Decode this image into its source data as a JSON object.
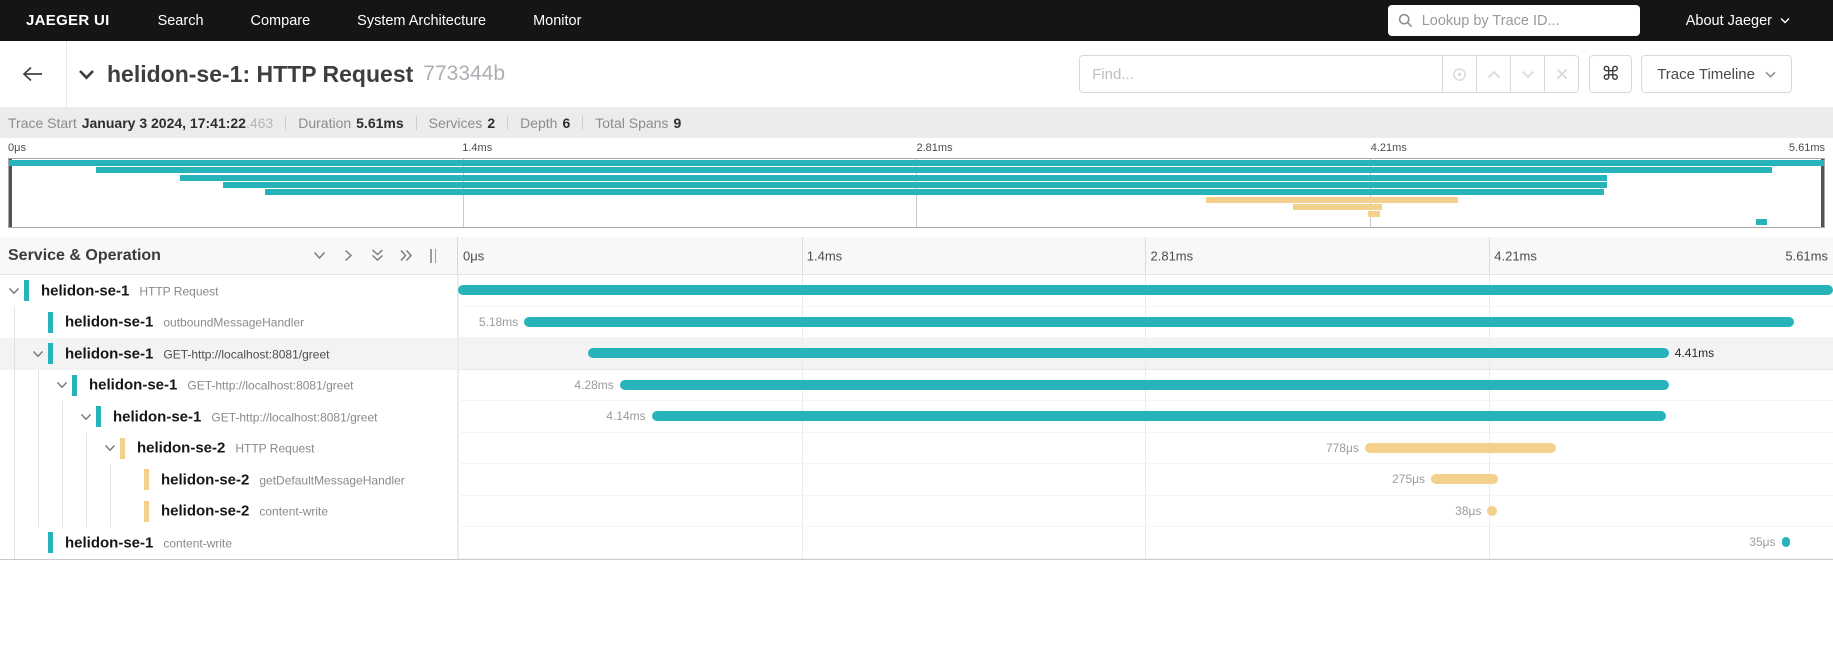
{
  "colors": {
    "teal": "#26b4ba",
    "yellow": "#f3d18c",
    "nav_bg": "#151515"
  },
  "nav": {
    "brand": "JAEGER UI",
    "items": [
      {
        "label": "Search"
      },
      {
        "label": "Compare"
      },
      {
        "label": "System Architecture"
      },
      {
        "label": "Monitor"
      }
    ],
    "trace_lookup_placeholder": "Lookup by Trace ID...",
    "about_label": "About Jaeger"
  },
  "trace_header": {
    "title": "helidon-se-1: HTTP Request",
    "trace_id": "773344b",
    "find_placeholder": "Find...",
    "cmd_glyph": "⌘",
    "view_selector_label": "Trace Timeline"
  },
  "summary": {
    "trace_start_label": "Trace Start",
    "trace_start_value": "January 3 2024, 17:41:22",
    "trace_start_fraction": ".463",
    "duration_label": "Duration",
    "duration_value": "5.61ms",
    "services_label": "Services",
    "services_value": "2",
    "depth_label": "Depth",
    "depth_value": "6",
    "total_spans_label": "Total Spans",
    "total_spans_value": "9"
  },
  "timeline": {
    "duration_ms": 5.61,
    "ticks": [
      "0μs",
      "1.4ms",
      "2.81ms",
      "4.21ms",
      "5.61ms"
    ]
  },
  "table": {
    "header_label": "Service & Operation"
  },
  "spans": [
    {
      "service": "helidon-se-1",
      "operation": "HTTP Request",
      "depth": 0,
      "expandable": true,
      "color": "teal",
      "start_ms": 0.0,
      "duration_ms": 5.61,
      "duration_label": null,
      "label_side": null,
      "highlight": false
    },
    {
      "service": "helidon-se-1",
      "operation": "outboundMessageHandler",
      "depth": 1,
      "expandable": false,
      "color": "teal",
      "start_ms": 0.27,
      "duration_ms": 5.18,
      "duration_label": "5.18ms",
      "label_side": "left",
      "highlight": false
    },
    {
      "service": "helidon-se-1",
      "operation": "GET-http://localhost:8081/greet",
      "depth": 1,
      "expandable": true,
      "color": "teal",
      "start_ms": 0.53,
      "duration_ms": 4.41,
      "duration_label": "4.41ms",
      "label_side": "right",
      "highlight": true
    },
    {
      "service": "helidon-se-1",
      "operation": "GET-http://localhost:8081/greet",
      "depth": 2,
      "expandable": true,
      "color": "teal",
      "start_ms": 0.66,
      "duration_ms": 4.28,
      "duration_label": "4.28ms",
      "label_side": "left",
      "highlight": false
    },
    {
      "service": "helidon-se-1",
      "operation": "GET-http://localhost:8081/greet",
      "depth": 3,
      "expandable": true,
      "color": "teal",
      "start_ms": 0.79,
      "duration_ms": 4.14,
      "duration_label": "4.14ms",
      "label_side": "left",
      "highlight": false
    },
    {
      "service": "helidon-se-2",
      "operation": "HTTP Request",
      "depth": 4,
      "expandable": true,
      "color": "yellow",
      "start_ms": 3.7,
      "duration_ms": 0.778,
      "duration_label": "778μs",
      "label_side": "left",
      "highlight": false
    },
    {
      "service": "helidon-se-2",
      "operation": "getDefaultMessageHandler",
      "depth": 5,
      "expandable": false,
      "color": "yellow",
      "start_ms": 3.97,
      "duration_ms": 0.275,
      "duration_label": "275μs",
      "label_side": "left",
      "highlight": false
    },
    {
      "service": "helidon-se-2",
      "operation": "content-write",
      "depth": 5,
      "expandable": false,
      "color": "yellow",
      "start_ms": 4.2,
      "duration_ms": 0.038,
      "duration_label": "38μs",
      "label_side": "left",
      "highlight": false
    },
    {
      "service": "helidon-se-1",
      "operation": "content-write",
      "depth": 1,
      "expandable": false,
      "color": "teal",
      "start_ms": 5.4,
      "duration_ms": 0.035,
      "duration_label": "35μs",
      "label_side": "left",
      "highlight": false
    }
  ]
}
